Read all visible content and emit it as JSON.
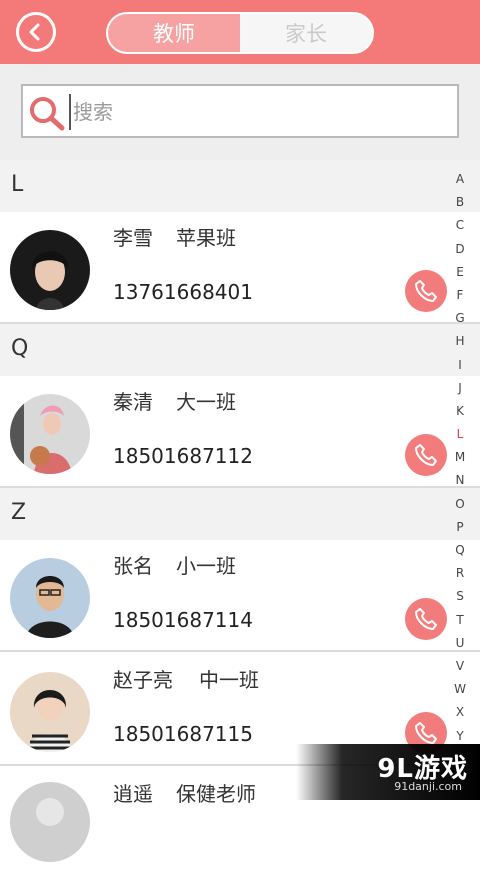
{
  "header": {
    "tabs": [
      {
        "label": "教师",
        "active": true
      },
      {
        "label": "家长",
        "active": false
      }
    ],
    "accent_color": "#f47a7a"
  },
  "search": {
    "placeholder": "搜索",
    "value": ""
  },
  "sections": [
    {
      "letter": "L",
      "contacts": [
        {
          "name": "李雪",
          "class": "苹果班",
          "phone": "13761668401"
        }
      ]
    },
    {
      "letter": "Q",
      "contacts": [
        {
          "name": "秦清",
          "class": "大一班",
          "phone": "18501687112"
        }
      ]
    },
    {
      "letter": "Z",
      "contacts": [
        {
          "name": "张名",
          "class": "小一班",
          "phone": "18501687114"
        },
        {
          "name": "赵子亮",
          "class": "中一班",
          "phone": "18501687115"
        },
        {
          "name": "逍遥",
          "class": "保健老师",
          "phone": ""
        }
      ]
    }
  ],
  "index_bar": {
    "letters": [
      "A",
      "B",
      "C",
      "D",
      "E",
      "F",
      "G",
      "H",
      "I",
      "J",
      "K",
      "L",
      "M",
      "N",
      "O",
      "P",
      "Q",
      "R",
      "S",
      "T",
      "U",
      "V",
      "W",
      "X",
      "Y"
    ],
    "active": "L"
  },
  "watermark": {
    "main": "9L游戏",
    "sub": "91danji.com"
  },
  "icons": [
    "back-icon",
    "search-icon",
    "phone-icon"
  ]
}
